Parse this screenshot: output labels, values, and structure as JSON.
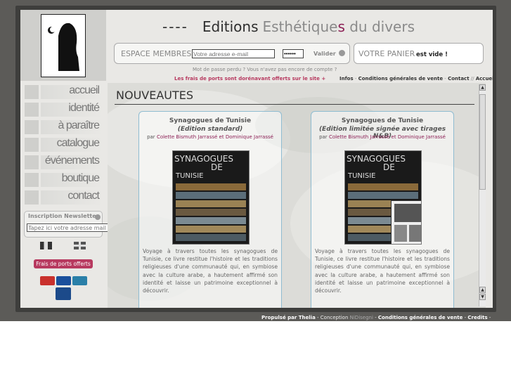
{
  "header": {
    "dashes": "----",
    "title_main": "Editions",
    "title_sub1": "Esthétique",
    "title_acc": "s",
    "title_sub2": "du divers"
  },
  "member": {
    "label": "ESPACE MEMBRES",
    "email_placeholder": "Votre adresse e-mail",
    "password_value": "••••••",
    "validate_label": "Valider"
  },
  "cart": {
    "label": "VOTRE PANIER",
    "status": "est vide !"
  },
  "password_help": "Mot de passe perdu ?   Vous n'avez pas encore de compte ?",
  "shipping_notice": "Les frais de ports sont dorénavant offerts sur le site +",
  "top_links": [
    "Infos",
    "Conditions générales de vente",
    "Contact",
    "Accueil boutique"
  ],
  "nav": [
    "accueil",
    "identité",
    "à paraître",
    "catalogue",
    "événements",
    "boutique",
    "contact"
  ],
  "newsletter": {
    "title": "Inscription Newsletter",
    "placeholder": "Tapez ici votre adresse mail"
  },
  "frais_button": "Frais de ports offerts",
  "section_title": "NOUVEAUTES",
  "products": [
    {
      "title": "Synagogues de Tunisie",
      "edition": "(Edition standard)",
      "by_prefix": "par",
      "authors": "Colette Bismuth Jarrassé et Dominique Jarrassé",
      "book_title": "SYNAGOGUES",
      "book_sub": "DE",
      "book_country": "TUNISIE",
      "description": "Voyage à travers toutes les synagogues de Tunisie, ce livre restitue l'histoire et les traditions religieuses d'une communauté qui, en symbiose avec la culture arabe, a hautement affirmé son identité et laisse un patrimoine exceptionnel à découvrir."
    },
    {
      "title": "Synagogues de Tunisie",
      "edition": "(Edition limitée signée avec tirages N&B)",
      "by_prefix": "par",
      "authors": "Colette Bismuth Jarrassé et Dominique Jarrassé",
      "book_title": "SYNAGOGUES",
      "book_sub": "DE",
      "book_country": "TUNISIE",
      "description": "Voyage à travers toutes les synagogues de Tunisie, ce livre restitue l'histoire et les traditions religieuses d'une communauté qui, en symbiose avec la culture arabe, a hautement affirmé son identité et laisse un patrimoine exceptionnel à découvrir."
    }
  ],
  "footer": {
    "powered": "Propulsé par Thelia",
    "sep1": " - Conception ",
    "design": "NiDisegni",
    "sep2": " - ",
    "cgv": "Conditions générales de vente",
    "sep3": " - ",
    "credits": "Credits",
    "sep4": " -"
  },
  "colors": {
    "accent": "#8c1f55",
    "frame": "#5c5b58",
    "border_blue": "#8fbcd1"
  }
}
